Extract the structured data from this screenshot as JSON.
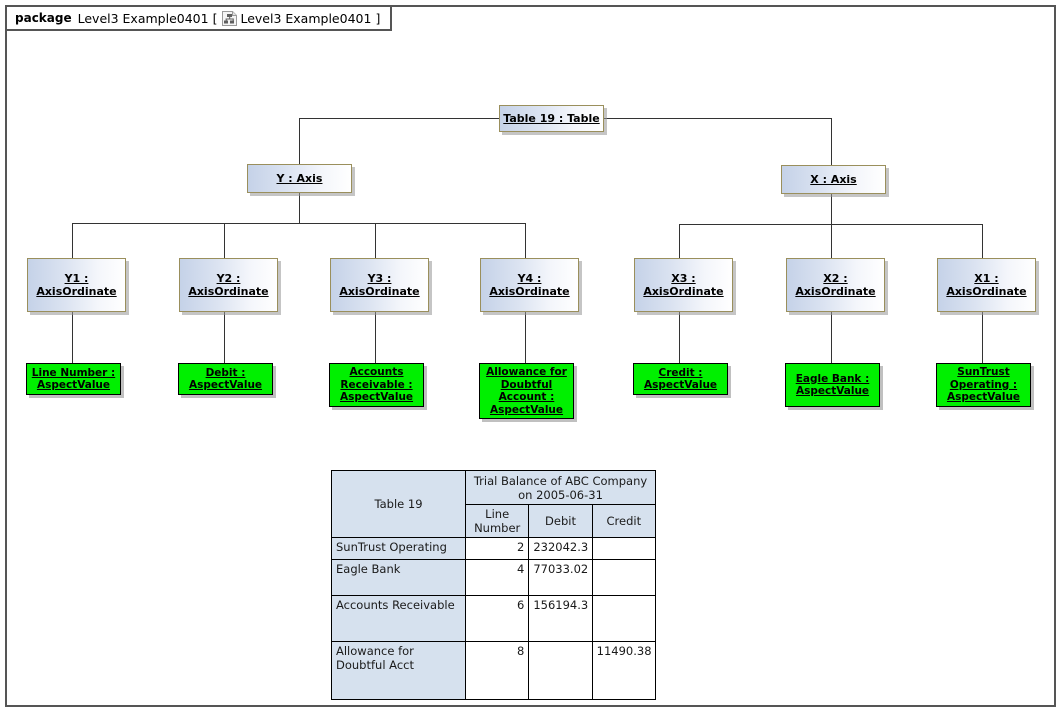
{
  "frame": {
    "keyword": "package",
    "name": "Level3 Example0401",
    "bracket_open": "[",
    "bracket_close": "]",
    "tab_diagram_name": "Level3 Example0401",
    "icon": "hierarchy-icon"
  },
  "colors": {
    "classifier_border": "#9a8f5c",
    "classifier_fill_start": "#c5d2e8",
    "classifier_fill_end": "#ffffff",
    "aspect_value_fill": "#00f000",
    "aspect_value_border": "#000000",
    "connector": "#333333",
    "table_header_fill": "#d6e1ee",
    "frame_border": "#555555"
  },
  "nodes": {
    "root": {
      "label": "Table 19 : Table"
    },
    "axes": [
      {
        "label": "Y : Axis"
      },
      {
        "label": "X : Axis"
      }
    ],
    "ordinates": [
      {
        "label": "Y1 :\nAxisOrdinate"
      },
      {
        "label": "Y2 :\nAxisOrdinate"
      },
      {
        "label": "Y3 :\nAxisOrdinate"
      },
      {
        "label": "Y4 :\nAxisOrdinate"
      },
      {
        "label": "X3 :\nAxisOrdinate"
      },
      {
        "label": "X2 :\nAxisOrdinate"
      },
      {
        "label": "X1 :\nAxisOrdinate"
      }
    ],
    "aspect_values": [
      {
        "label": "Line Number :\nAspectValue"
      },
      {
        "label": "Debit :\nAspectValue"
      },
      {
        "label": "Accounts\nReceivable :\nAspectValue"
      },
      {
        "label": "Allowance for\nDoubtful\nAccount :\nAspectValue"
      },
      {
        "label": "Credit :\nAspectValue"
      },
      {
        "label": "Eagle Bank :\nAspectValue"
      },
      {
        "label": "SunTrust\nOperating :\nAspectValue"
      }
    ]
  },
  "table": {
    "corner_label": "Table 19",
    "title": "Trial Balance of ABC Company on 2005-06-31",
    "column_headers": [
      "Line\nNumber",
      "Debit",
      "Credit"
    ],
    "rows": [
      {
        "stub": "SunTrust Operating",
        "line_number": "2",
        "debit": "232042.3",
        "credit": ""
      },
      {
        "stub": "Eagle Bank",
        "line_number": "4",
        "debit": "77033.02",
        "credit": ""
      },
      {
        "stub": "Accounts Receivable",
        "line_number": "6",
        "debit": "156194.3",
        "credit": ""
      },
      {
        "stub": "Allowance for\nDoubtful Acct",
        "line_number": "8",
        "debit": "",
        "credit": "11490.38"
      }
    ]
  }
}
